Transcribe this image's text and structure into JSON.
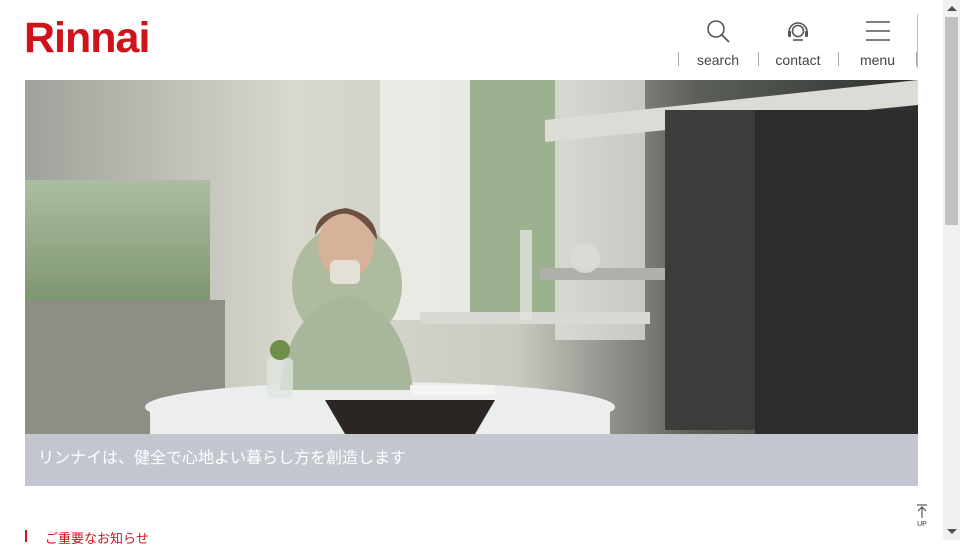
{
  "header": {
    "logo_text": "Rinnai",
    "nav": [
      {
        "label": "search",
        "icon": "search-icon"
      },
      {
        "label": "contact",
        "icon": "headset-icon"
      },
      {
        "label": "menu",
        "icon": "hamburger-menu-icon"
      }
    ]
  },
  "hero": {
    "caption": "リンナイは、健全で心地よい暮らし方を創造します"
  },
  "news": {
    "heading": "ご重要なお知らせ"
  },
  "page_top": {
    "label": "UP"
  },
  "colors": {
    "brand": "#d0121b",
    "caption_bg": "#c3c6cf"
  }
}
